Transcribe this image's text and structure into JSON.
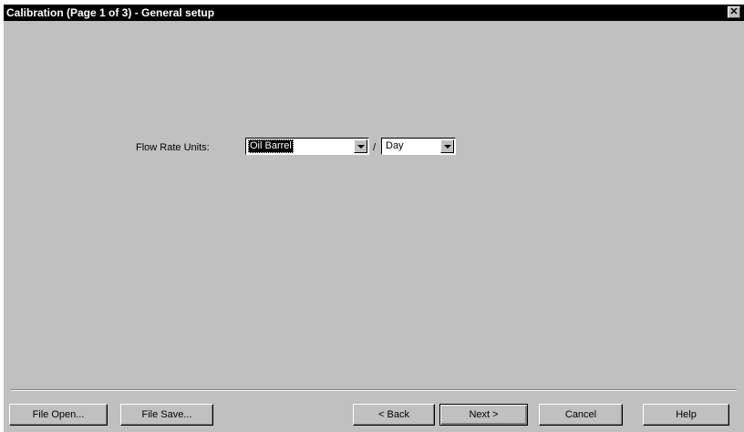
{
  "window": {
    "title": "Calibration (Page 1 of 3) - General setup",
    "close_glyph": "✕"
  },
  "form": {
    "flow_rate_label": "Flow Rate Units:",
    "units_value": "Oil Barrel",
    "separator": "/",
    "time_value": "Day"
  },
  "buttons": {
    "file_open": "File Open...",
    "file_save": "File Save...",
    "back": "< Back",
    "next": "Next >",
    "cancel": "Cancel",
    "help": "Help"
  },
  "colors": {
    "dialog_bg": "#c0c0c0",
    "titlebar_bg": "#000000",
    "titlebar_text": "#ffffff"
  }
}
